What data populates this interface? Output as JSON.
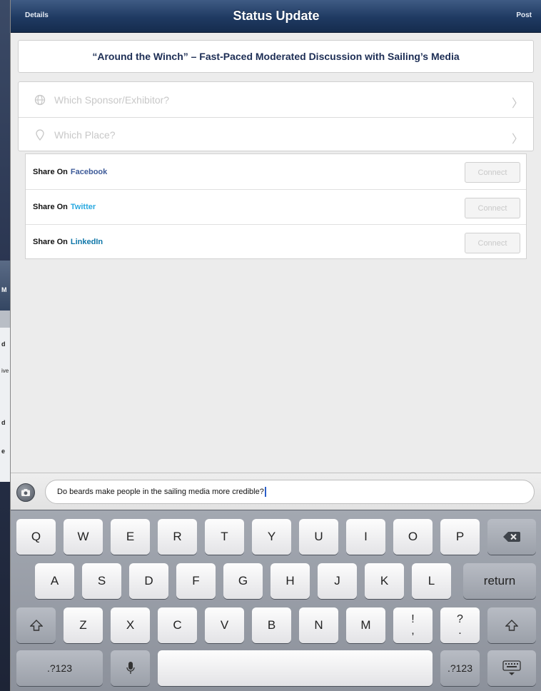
{
  "background_app": {
    "fragments": [
      "M",
      "d",
      "ive",
      "d",
      "e"
    ]
  },
  "navbar": {
    "left_label": "Details",
    "title": "Status Update",
    "right_label": "Post"
  },
  "session_title": "“Around the Winch” – Fast-Paced Moderated Discussion with Sailing’s Media",
  "selectors": [
    {
      "icon": "globe-icon",
      "placeholder": "Which Sponsor/Exhibitor?"
    },
    {
      "icon": "location-pin-icon",
      "placeholder": "Which Place?"
    }
  ],
  "share": {
    "prefix": "Share On",
    "rows": [
      {
        "network": "Facebook",
        "button": "Connect",
        "color": "#3d5a98"
      },
      {
        "network": "Twitter",
        "button": "Connect",
        "color": "#2aa9e0"
      },
      {
        "network": "LinkedIn",
        "button": "Connect",
        "color": "#0e76a8"
      }
    ]
  },
  "compose": {
    "text": "Do beards make people in the sailing media more credible?"
  },
  "keyboard": {
    "row1": [
      "Q",
      "W",
      "E",
      "R",
      "T",
      "Y",
      "U",
      "I",
      "O",
      "P"
    ],
    "row2": [
      "A",
      "S",
      "D",
      "F",
      "G",
      "H",
      "J",
      "K",
      "L"
    ],
    "return_label": "return",
    "row3": [
      "Z",
      "X",
      "C",
      "V",
      "B",
      "N",
      "M"
    ],
    "punct1": {
      "top": "!",
      "bottom": ","
    },
    "punct2": {
      "top": "?",
      "bottom": "."
    },
    "numbers_label": ".?123"
  }
}
